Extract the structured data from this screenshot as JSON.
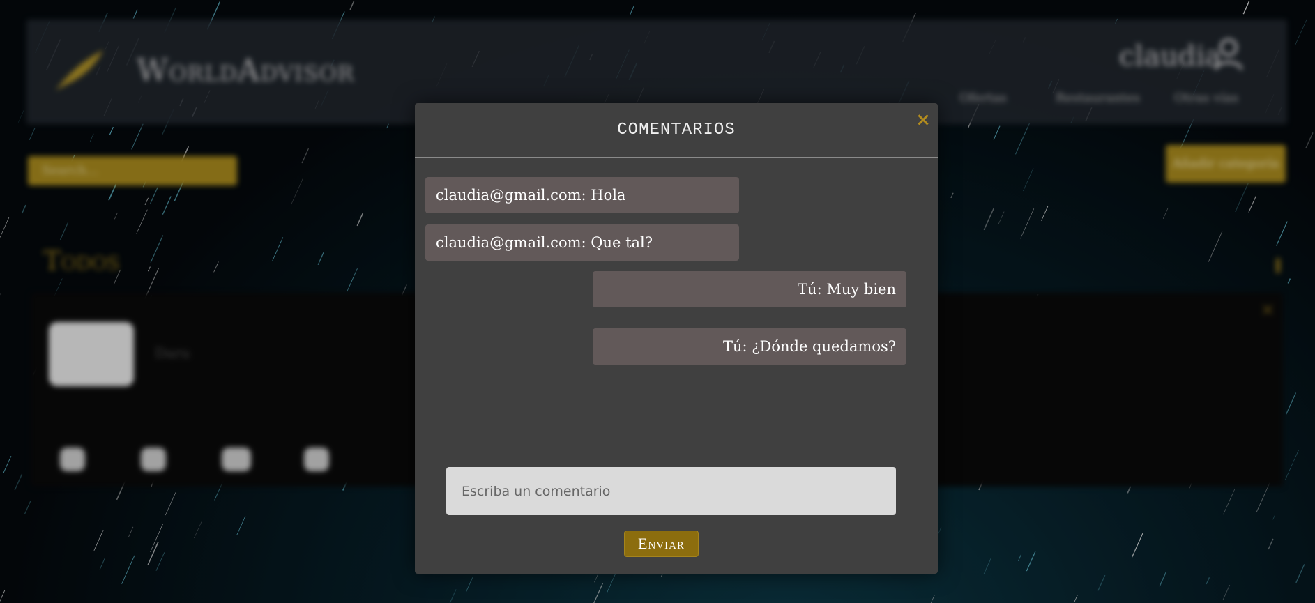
{
  "background": {
    "brand": "WorldAdvisor",
    "user": "claudia",
    "nav": [
      "Ofertas",
      "Restaurantes",
      "Otras vías"
    ],
    "search_placeholder": "Search...",
    "add_button": "Añadir categoría",
    "section_title": "Todos",
    "card_text": "Daru"
  },
  "modal": {
    "title": "COMENTARIOS",
    "close_icon": "×",
    "messages": [
      {
        "text": "claudia@gmail.com: Hola",
        "author": "other"
      },
      {
        "text": "claudia@gmail.com: Que tal?",
        "author": "other"
      },
      {
        "text": "Tú: Muy bien",
        "author": "mine"
      },
      {
        "text": "Tú: ¿Dónde quedamos?",
        "author": "mine"
      }
    ],
    "input_placeholder": "Escriba un comentario",
    "input_value": "",
    "send_label": "Enviar"
  },
  "colors": {
    "accent": "#8c6d0e",
    "modal_bg": "#404040",
    "bubble_bg": "#625959",
    "close": "#b38c1e"
  },
  "icons": {
    "logo": "quill-logo-icon",
    "user": "user-icon",
    "actions": [
      "like-icon",
      "comment-icon",
      "group-icon",
      "share-icon"
    ]
  }
}
